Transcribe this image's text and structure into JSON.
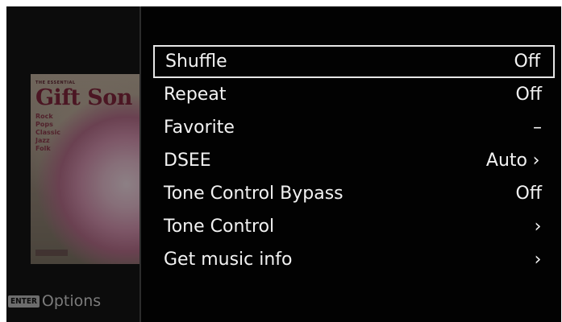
{
  "left_pane": {
    "album_art": {
      "subtitle": "THE ESSENTIAL",
      "title": "Gift Son",
      "genres": [
        "Rock",
        "Pops",
        "Classic",
        "Jazz",
        "Folk"
      ]
    },
    "enter_hint": {
      "key": "ENTER",
      "label": "Options"
    }
  },
  "menu": {
    "selected_index": 0,
    "items": [
      {
        "label": "Shuffle",
        "value": "Off"
      },
      {
        "label": "Repeat",
        "value": "Off"
      },
      {
        "label": "Favorite",
        "value": "–"
      },
      {
        "label": "DSEE",
        "value": "Auto",
        "has_submenu": true
      },
      {
        "label": "Tone Control Bypass",
        "value": "Off"
      },
      {
        "label": "Tone Control",
        "value": "",
        "has_submenu": true
      },
      {
        "label": "Get music info",
        "value": "",
        "has_submenu": true
      }
    ]
  },
  "icons": {
    "submenu": "chevron-right-icon"
  },
  "colors": {
    "background": "#050505",
    "text": "#f2f2f2",
    "selection_border": "#e6e6e6",
    "hint_text": "#7b7b7b"
  }
}
